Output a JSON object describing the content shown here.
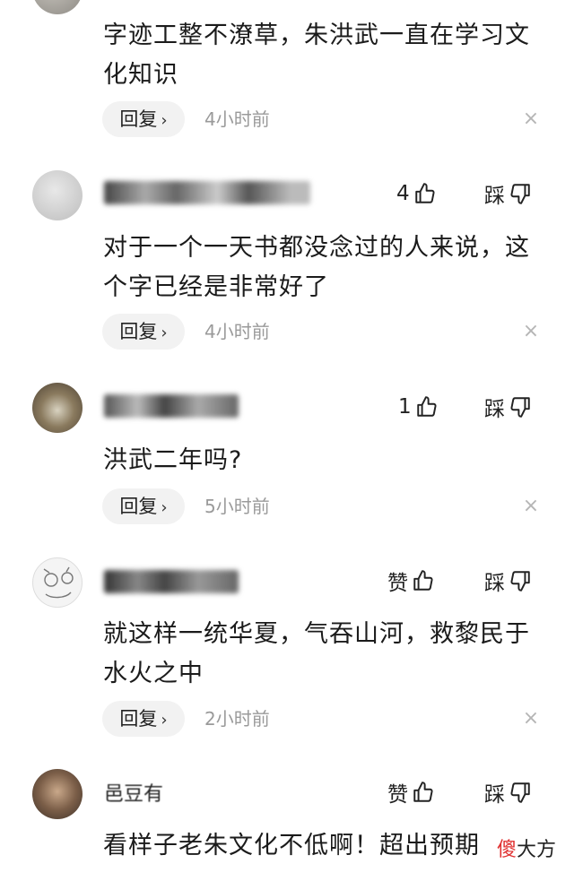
{
  "comments": [
    {
      "text_line1": "字迹工整不潦草，朱洪武一直在学习文",
      "text_line2": "化知识",
      "reply_label": "回复",
      "time": "4小时前",
      "close": "×"
    },
    {
      "like_label": "4",
      "dislike_label": "踩",
      "text_line1": "对于一个一天书都没念过的人来说，这",
      "text_line2": "个字已经是非常好了",
      "reply_label": "回复",
      "time": "4小时前",
      "close": "×"
    },
    {
      "like_label": "1",
      "dislike_label": "踩",
      "text_line1": "洪武二年吗?",
      "reply_label": "回复",
      "time": "5小时前",
      "close": "×"
    },
    {
      "like_label": "赞",
      "dislike_label": "踩",
      "text_line1": "就这样一统华夏，气吞山河，救黎民于",
      "text_line2": "水火之中",
      "reply_label": "回复",
      "time": "2小时前",
      "close": "×"
    },
    {
      "username": "邑豆有",
      "like_label": "赞",
      "dislike_label": "踩",
      "text_line1": "看样子老朱文化不低啊！超出预期"
    }
  ],
  "watermark": {
    "char1": "傻",
    "rest": "大方"
  },
  "icons": {
    "thumb_up": "thumbs-up-icon",
    "thumb_down": "thumbs-down-icon",
    "chevron": "chevron-right-icon",
    "close": "close-icon"
  }
}
